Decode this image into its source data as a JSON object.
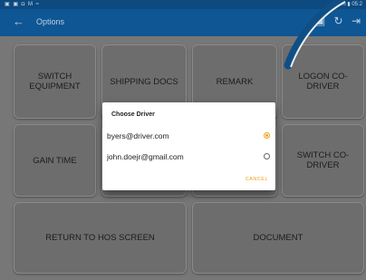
{
  "status": {
    "left": "▣ ▣ ◘ M ≈",
    "right": "82% ▮ 05:2"
  },
  "appbar": {
    "title": "Options",
    "back_icon": "back-arrow-icon"
  },
  "tiles": {
    "switch_equipment": "SWITCH EQUIPMENT",
    "shipping_docs": "SHIPPING DOCS",
    "remark": "REMARK",
    "logon_codriver": "LOGON CO-DRIVER",
    "gain_time": "GAIN TIME",
    "switch_codriver": "SWITCH CO-DRIVER",
    "return_hos": "RETURN TO HOS SCREEN",
    "document": "DOCUMENT"
  },
  "dialog": {
    "title": "Choose Driver",
    "options": [
      "byers@driver.com",
      "john.doejr@gmail.com"
    ],
    "selected_index": 0,
    "cancel_label": "CANCEL"
  },
  "colors": {
    "appbar": "#0f5694",
    "accent": "#f0a019"
  }
}
